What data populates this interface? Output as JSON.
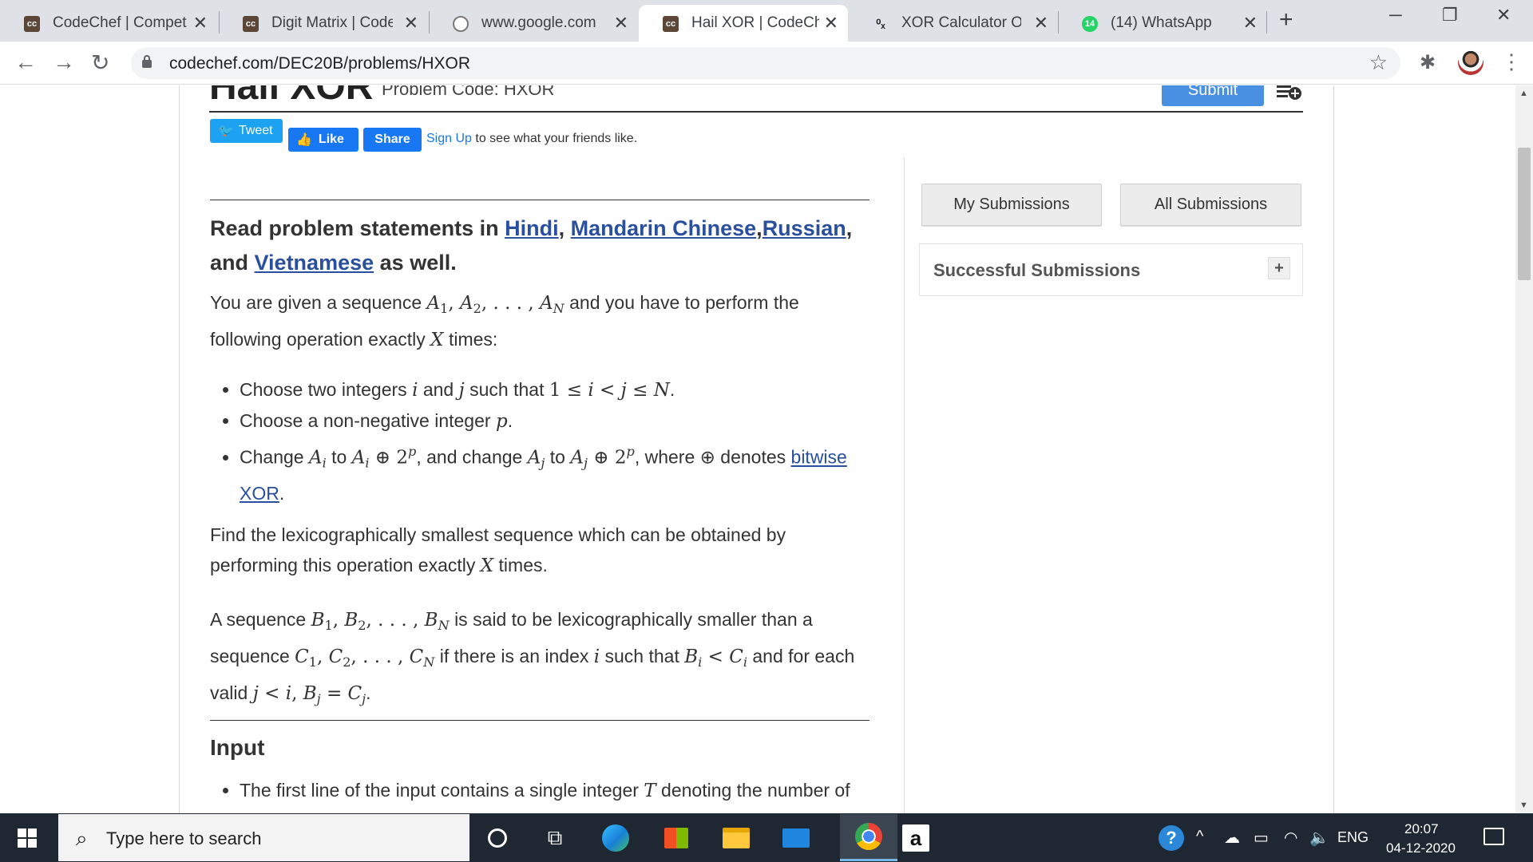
{
  "browser": {
    "tabs": [
      {
        "favicon": "cc-logo",
        "title": "CodeChef | Competit",
        "active": false
      },
      {
        "favicon": "cc-logo",
        "title": "Digit Matrix | CodeCh",
        "active": false
      },
      {
        "favicon": "globe-icon",
        "title": "www.google.com",
        "active": false
      },
      {
        "favicon": "cc-logo",
        "title": "Hail XOR | CodeChef",
        "active": true
      },
      {
        "favicon": "xor-calculator-icon",
        "title": "XOR Calculator Onlin",
        "active": false
      },
      {
        "favicon": "whatsapp-icon",
        "badge": "14",
        "title": "(14) WhatsApp",
        "active": false
      }
    ],
    "url": "codechef.com/DEC20B/problems/HXOR"
  },
  "problem": {
    "title": "Hail XOR",
    "code_label": "Problem Code: HXOR",
    "submit_label": "Submit"
  },
  "social": {
    "tweet_label": "Tweet",
    "like_label": "Like",
    "share_label": "Share",
    "signup_link": "Sign Up",
    "signup_suffix": "to see what your friends like."
  },
  "lang_notice": {
    "prefix": "Read problem statements in",
    "langs": [
      "Hindi",
      "Mandarin Chinese",
      "Russian",
      "Vietnamese"
    ],
    "and": "and",
    "suffix": "as well."
  },
  "statement": {
    "p1_a": "You are given a sequence",
    "p1_b": "and you have to perform the following operation exactly",
    "p1_c": "times:",
    "b1_a": "Choose two integers",
    "b1_b": "and",
    "b1_c": "such that",
    "b2_a": "Choose a non-negative integer",
    "b3_a": "Change",
    "b3_b": "to",
    "b3_c": ", and change",
    "b3_d": "to",
    "b3_e": ", where ⊕ denotes",
    "b3_link": "bitwise XOR",
    "p2_a": "Find the lexicographically smallest sequence which can be obtained by performing this operation exactly",
    "p2_b": "times.",
    "p3_a": "A sequence",
    "p3_b": "is said to be lexicographically smaller than a sequence",
    "p3_c": "if there is an index",
    "p3_d": "such that",
    "p3_e": "and for each valid",
    "input_heading": "Input",
    "input_b1": "The first line of the input contains a single integer",
    "input_b1_end": "denoting the number of"
  },
  "sidebar": {
    "my_submissions": "My Submissions",
    "all_submissions": "All Submissions",
    "successful_submissions": "Successful Submissions",
    "toggle": "+"
  },
  "taskbar": {
    "search_placeholder": "Type here to search",
    "language": "ENG",
    "time": "20:07",
    "date": "04-12-2020"
  }
}
